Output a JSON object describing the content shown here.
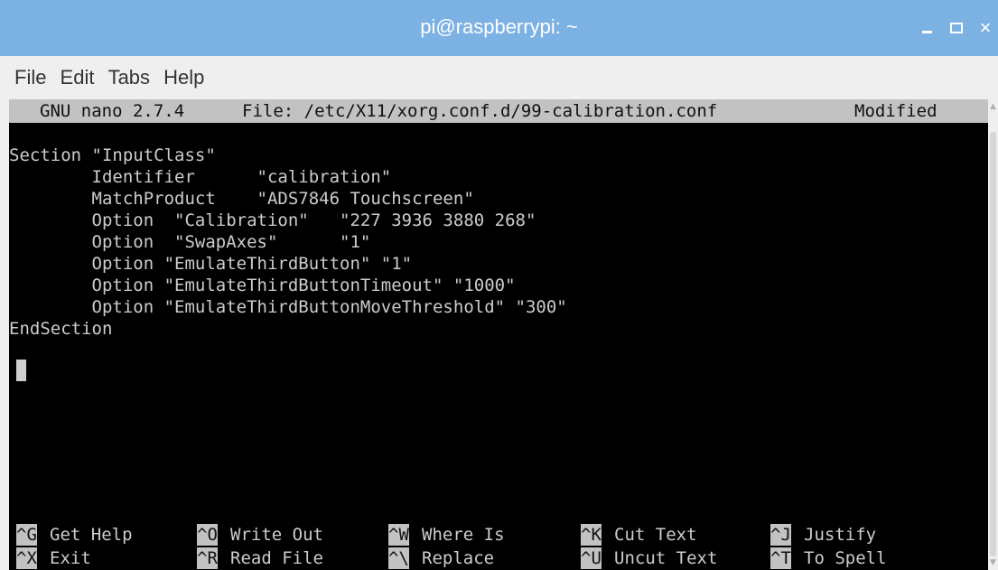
{
  "window": {
    "title": "pi@raspberrypi: ~",
    "controls": {
      "minimize": "minimize",
      "maximize": "maximize",
      "close": "×"
    }
  },
  "menu": [
    "File",
    "Edit",
    "Tabs",
    "Help"
  ],
  "nano": {
    "version": "GNU nano 2.7.4",
    "file": "File: /etc/X11/xorg.conf.d/99-calibration.conf",
    "status": "Modified"
  },
  "content_lines": [
    "Section \"InputClass\"",
    "        Identifier      \"calibration\"",
    "        MatchProduct    \"ADS7846 Touchscreen\"",
    "        Option  \"Calibration\"   \"227 3936 3880 268\"",
    "        Option  \"SwapAxes\"      \"1\"",
    "        Option \"EmulateThirdButton\" \"1\"",
    "        Option \"EmulateThirdButtonTimeout\" \"1000\"",
    "        Option \"EmulateThirdButtonMoveThreshold\" \"300\"",
    "EndSection"
  ],
  "shortcuts": [
    {
      "key": "^G",
      "label": "Get Help"
    },
    {
      "key": "^O",
      "label": "Write Out"
    },
    {
      "key": "^W",
      "label": "Where Is"
    },
    {
      "key": "^K",
      "label": "Cut Text"
    },
    {
      "key": "^J",
      "label": "Justify"
    },
    {
      "key": "^X",
      "label": "Exit"
    },
    {
      "key": "^R",
      "label": "Read File"
    },
    {
      "key": "^\\",
      "label": "Replace"
    },
    {
      "key": "^U",
      "label": "Uncut Text"
    },
    {
      "key": "^T",
      "label": "To Spell"
    }
  ]
}
